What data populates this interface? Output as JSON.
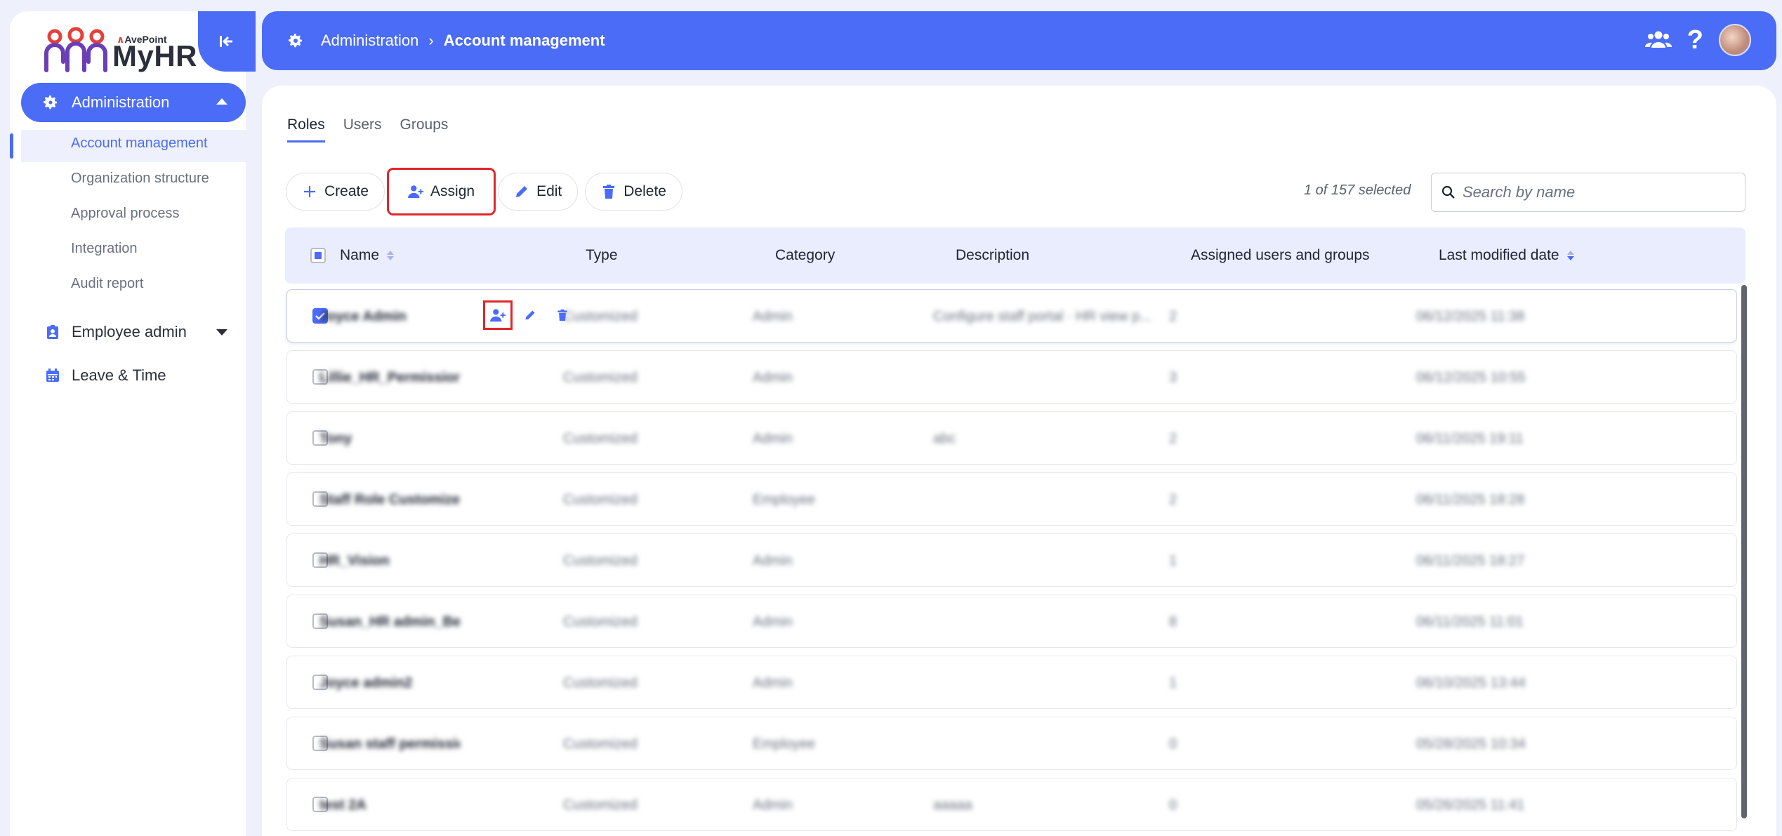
{
  "sidebar": {
    "logo": {
      "brand": "AvePoint",
      "name": "MyHR"
    },
    "nav": [
      {
        "label": "Administration",
        "icon": "gear-icon",
        "expanded": true,
        "items": [
          {
            "label": "Account management",
            "active": true
          },
          {
            "label": "Organization structure"
          },
          {
            "label": "Approval process"
          },
          {
            "label": "Integration"
          },
          {
            "label": "Audit report"
          }
        ]
      },
      {
        "label": "Employee admin",
        "icon": "badge-icon"
      },
      {
        "label": "Leave & Time",
        "icon": "calendar-icon"
      }
    ]
  },
  "header": {
    "breadcrumb": [
      "Administration",
      "Account management"
    ]
  },
  "tabs": [
    "Roles",
    "Users",
    "Groups"
  ],
  "toolbar": {
    "create": "Create",
    "assign": "Assign",
    "edit": "Edit",
    "delete": "Delete",
    "selection": "1 of 157 selected",
    "search_placeholder": "Search by name"
  },
  "table": {
    "columns": [
      "Name",
      "Type",
      "Category",
      "Description",
      "Assigned users and groups",
      "Last modified date"
    ],
    "rows": [
      {
        "name": "Joyce Admin",
        "type": "Customized",
        "category": "Admin",
        "description": "Configure staff portal · HR view p...",
        "assigned": "2",
        "modified": "06/12/2025 11:38",
        "selected": true
      },
      {
        "name": "Lillie_HR_Permission_VN",
        "type": "Customized",
        "category": "Admin",
        "description": "",
        "assigned": "3",
        "modified": "06/12/2025 10:55"
      },
      {
        "name": "Tony",
        "type": "Customized",
        "category": "Admin",
        "description": "abc",
        "assigned": "2",
        "modified": "06/11/2025 19:11"
      },
      {
        "name": "Staff Role Customized",
        "type": "Customized",
        "category": "Employee",
        "description": "",
        "assigned": "2",
        "modified": "06/11/2025 18:28"
      },
      {
        "name": "HR_Vision",
        "type": "Customized",
        "category": "Admin",
        "description": "",
        "assigned": "1",
        "modified": "06/11/2025 18:27"
      },
      {
        "name": "Susan_HR admin_Beijing",
        "type": "Customized",
        "category": "Admin",
        "description": "",
        "assigned": "8",
        "modified": "06/11/2025 11:01"
      },
      {
        "name": "Joyce admin2",
        "type": "Customized",
        "category": "Admin",
        "description": "",
        "assigned": "1",
        "modified": "06/10/2025 13:44"
      },
      {
        "name": "Susan staff permission",
        "type": "Customized",
        "category": "Employee",
        "description": "",
        "assigned": "0",
        "modified": "05/28/2025 10:34"
      },
      {
        "name": "test 2A",
        "type": "Customized",
        "category": "Admin",
        "description": "aaaaa",
        "assigned": "0",
        "modified": "05/26/2025 11:41"
      }
    ]
  },
  "colors": {
    "accent": "#4a6cf7",
    "highlight": "#e0262b"
  }
}
